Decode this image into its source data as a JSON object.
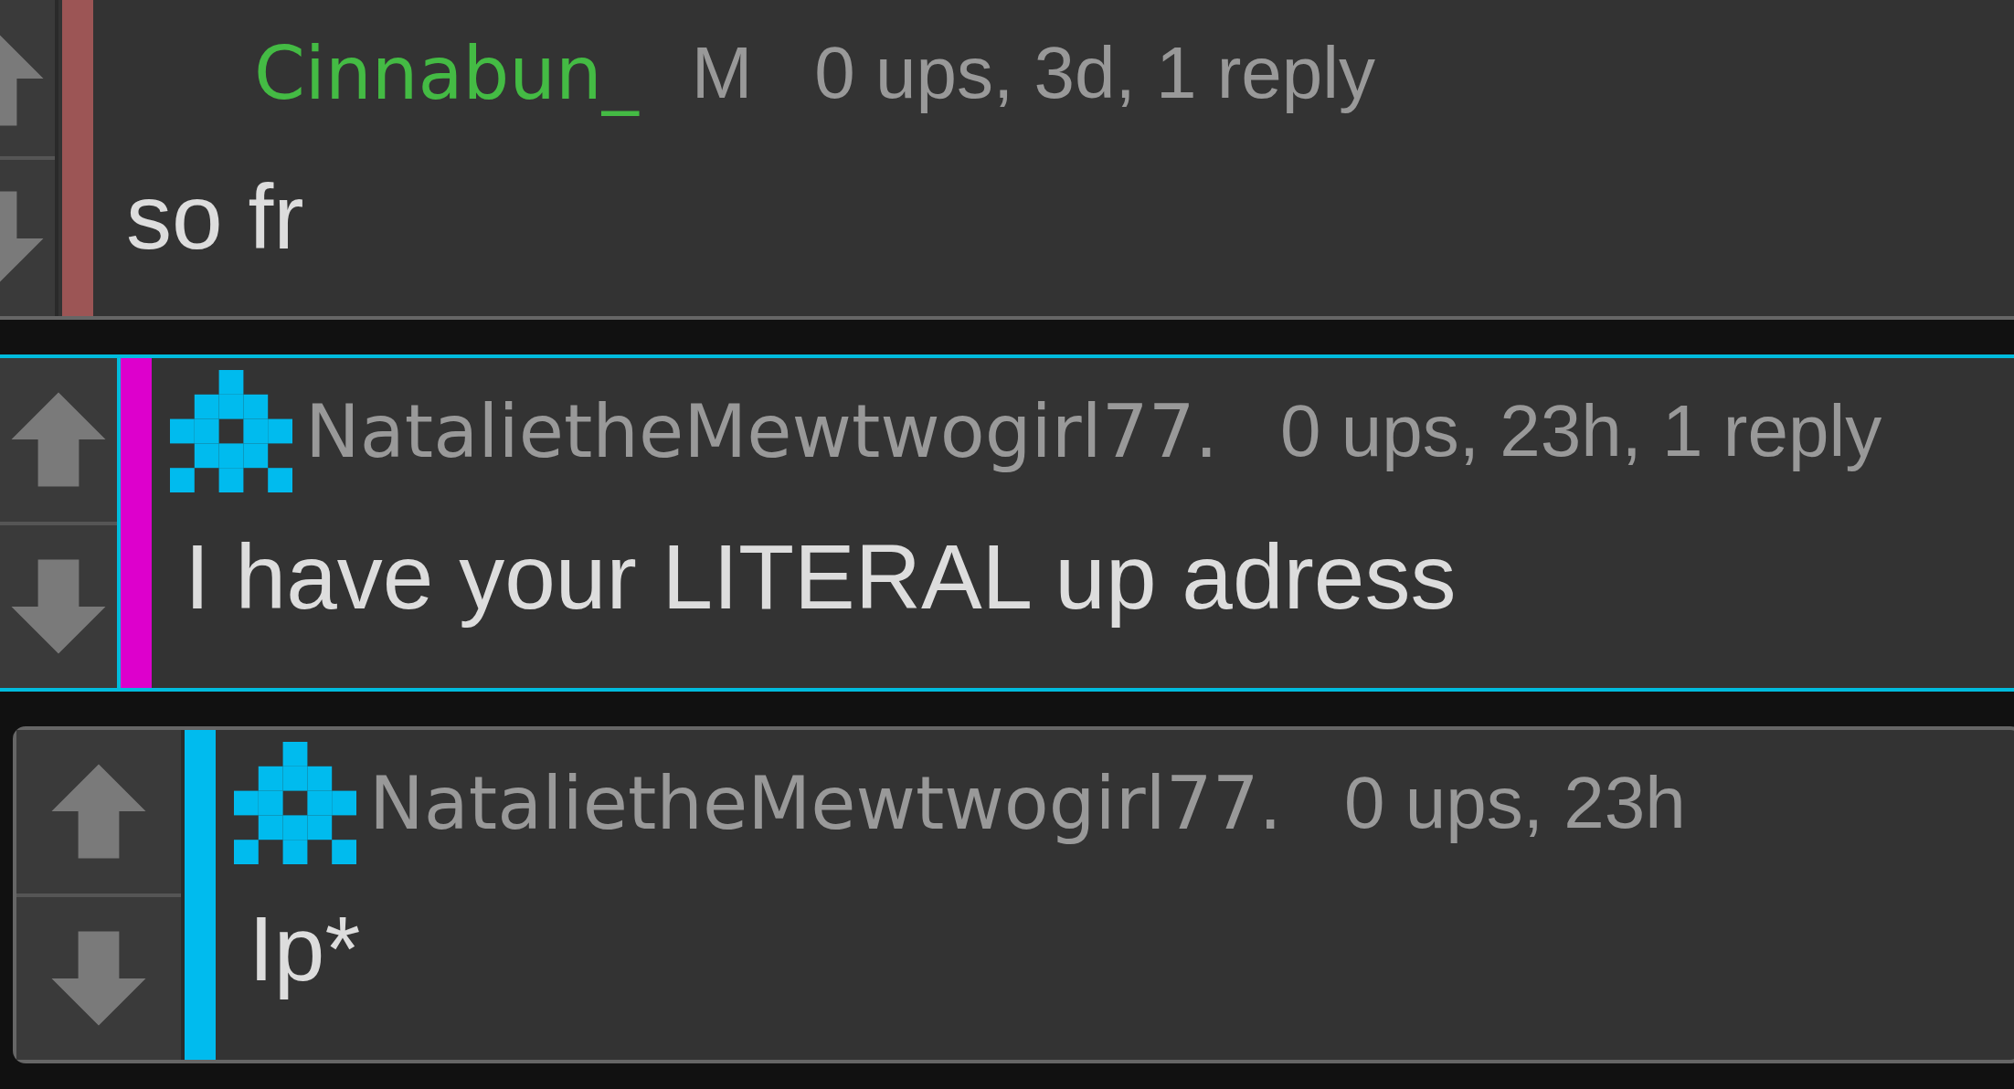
{
  "comments": [
    {
      "kind": "partial",
      "color": "#9c5555",
      "selected": false,
      "avatar": false,
      "highlighted": true,
      "username": "Cinnabun_",
      "badge": "M",
      "meta": "0 ups, 3d, 1 reply",
      "body": "so fr"
    },
    {
      "kind": "comment",
      "color": "#dd00cc",
      "selected": true,
      "avatar": true,
      "highlighted": false,
      "username": "NatalietheMewtwogirl77.",
      "meta": "0 ups, 23h, 1 reply",
      "body": "I have your LITERAL up adress"
    },
    {
      "kind": "reply",
      "color": "#00bbee",
      "selected": false,
      "avatar": true,
      "highlighted": false,
      "username": "NatalietheMewtwogirl77.",
      "meta": "0 ups, 23h",
      "body": "Ip*"
    }
  ]
}
